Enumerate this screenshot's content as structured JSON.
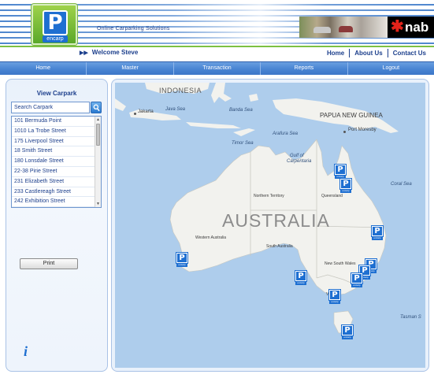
{
  "header": {
    "logo_text": "P",
    "logo_tag": "encarp",
    "tagline": "Online  Carparking  Solutions",
    "bank": "nab"
  },
  "welcome": "Welcome Steve",
  "top_links": [
    "Home",
    "About Us",
    "Contact Us"
  ],
  "nav": [
    "Home",
    "Master",
    "Transaction",
    "Reports",
    "Logout"
  ],
  "sidebar": {
    "title": "View Carpark",
    "search_placeholder": "Search Carpark",
    "carparks": [
      "101 Bermuda Point",
      "1010 La Trobe Street",
      "175 Liverpool Street",
      "18 Smith Street",
      "180 Lonsdale Street",
      "22-38 Pirie Street",
      "231 Elizabeth Street",
      "233 Castlereagh Street",
      "242 Exhibition Street"
    ],
    "print_label": "Print",
    "info_icon": "i"
  },
  "map": {
    "labels": {
      "indonesia": "INDONESIA",
      "jakarta": "Jakarta",
      "java_sea": "Java Sea",
      "banda_sea": "Banda Sea",
      "png": "PAPUA NEW GUINEA",
      "port_moresby": "Port Moresby",
      "timor_sea": "Timor Sea",
      "arafura_sea": "Arafura Sea",
      "gulf": "Gulf of",
      "gulf2": "Carpentaria",
      "coral_sea": "Coral Sea",
      "northern_territory": "Northern Territory",
      "queensland": "Queensland",
      "australia": "AUSTRALIA",
      "western_australia": "Western Australia",
      "south_australia": "South Australia",
      "nsw": "New South Wales",
      "victoria": "Victoria",
      "tasman_sea": "Tasman S"
    },
    "pin_letter": "P",
    "pin_tag": "encarp"
  },
  "colors": {
    "brand_blue": "#1e6fd1",
    "nav_blue": "#4b86d4",
    "brand_green": "#7cc142",
    "text_navy": "#1c3f8c",
    "sea": "#aecdec",
    "land": "#f2f2ee"
  }
}
